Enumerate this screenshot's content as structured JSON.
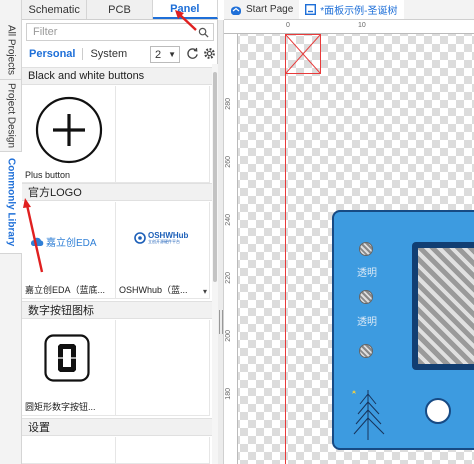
{
  "vertical_tabs": [
    {
      "label": "All Projects",
      "active": false
    },
    {
      "label": "Project Design",
      "active": false
    },
    {
      "label": "Commonly Library",
      "active": true
    }
  ],
  "panel_tabs": [
    {
      "label": "Schematic",
      "active": false
    },
    {
      "label": "PCB",
      "active": false
    },
    {
      "label": "Panel",
      "active": true
    }
  ],
  "filter": {
    "placeholder": "Filter",
    "value": ""
  },
  "library_tabs": [
    {
      "label": "Personal",
      "active": true
    },
    {
      "label": "System",
      "active": false
    }
  ],
  "zoom_select": {
    "value": "2"
  },
  "sections": [
    {
      "title": "Black and white buttons",
      "items": [
        {
          "caption": "Plus button"
        },
        {
          "caption": ""
        }
      ]
    },
    {
      "title": "官方LOGO",
      "items": [
        {
          "caption": "嘉立创EDA（蓝底...",
          "logo_text": "嘉立创EDA"
        },
        {
          "caption": "OSHWhub（蓝...",
          "logo_text": "OSHWHub",
          "logo_subtext": "立创开源硬件平台"
        }
      ]
    },
    {
      "title": "数字按钮图标",
      "items": [
        {
          "caption": "圆矩形数字按钮..."
        },
        {
          "caption": ""
        }
      ]
    },
    {
      "title": "设置",
      "items": []
    }
  ],
  "doc_tabs": [
    {
      "label": "Start Page",
      "icon": "home-icon",
      "active": false
    },
    {
      "label": "*面板示例-圣诞树",
      "icon": "panel-file-icon",
      "active": true
    }
  ],
  "ruler": {
    "top": [
      "0",
      "10"
    ],
    "left": [
      "280",
      "260",
      "240",
      "220",
      "200",
      "180"
    ]
  },
  "device": {
    "knob_labels": [
      "透明",
      "透明"
    ]
  },
  "colors": {
    "accent": "#1e6fd8",
    "device_fill": "#3d9be0",
    "device_border": "#174a84",
    "guide_red": "#e83a3a"
  }
}
